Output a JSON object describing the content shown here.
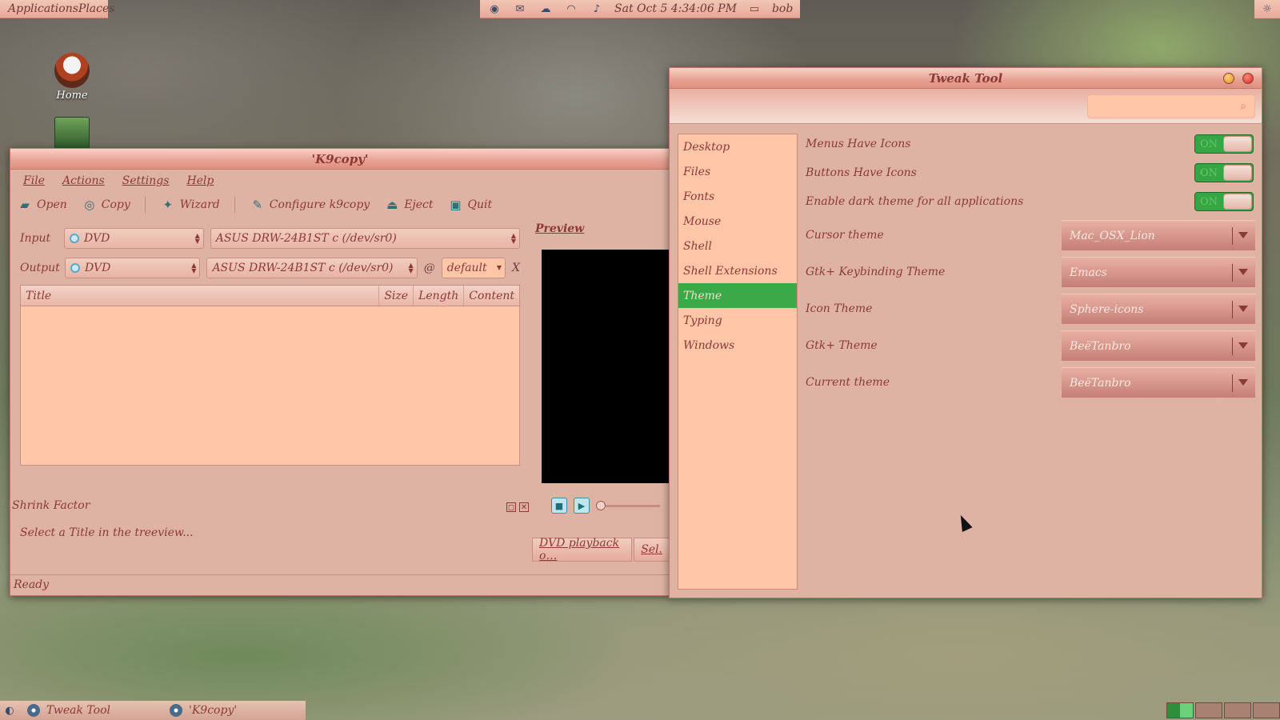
{
  "top_panel": {
    "menu_label": "ApplicationsPlaces",
    "clock": "Sat Oct  5   4:34:06 PM",
    "user": "bob"
  },
  "desktop": {
    "home_label": "Home"
  },
  "k9copy": {
    "title": "'K9copy'",
    "menu": [
      "File",
      "Actions",
      "Settings",
      "Help"
    ],
    "toolbar": {
      "open": "Open",
      "copy": "Copy",
      "wizard": "Wizard",
      "configure": "Configure k9copy",
      "eject": "Eject",
      "quit": "Quit"
    },
    "input_label": "Input",
    "output_label": "Output",
    "input_type": "DVD",
    "output_type": "DVD",
    "input_device": "ASUS    DRW-24B1ST   c  (/dev/sr0)",
    "output_device": "ASUS    DRW-24B1ST   c  (/dev/sr0)",
    "at_sign": "@",
    "speed": "default",
    "clear": "X",
    "columns": [
      "Title",
      "Size",
      "Length",
      "Content"
    ],
    "preview_label": "Preview",
    "shrink_label": "Shrink Factor",
    "hint": "Select a Title in the treeview...",
    "tabs": [
      "DVD playback o…",
      "Sel."
    ],
    "status": "Ready"
  },
  "tweak": {
    "title": "Tweak Tool",
    "search_placeholder": "",
    "sidebar": [
      "Desktop",
      "Files",
      "Fonts",
      "Mouse",
      "Shell",
      "Shell Extensions",
      "Theme",
      "Typing",
      "Windows"
    ],
    "active_index": 6,
    "switches": [
      {
        "label": "Menus Have Icons",
        "state": "ON"
      },
      {
        "label": "Buttons Have Icons",
        "state": "ON"
      },
      {
        "label": "Enable dark theme for all applications",
        "state": "ON"
      }
    ],
    "dropdowns": [
      {
        "label": "Cursor theme",
        "value": "Mac_OSX_Lion"
      },
      {
        "label": "Gtk+ Keybinding Theme",
        "value": "Emacs"
      },
      {
        "label": "Icon Theme",
        "value": "Sphere-icons"
      },
      {
        "label": "Gtk+ Theme",
        "value": "BeëTanbro"
      },
      {
        "label": "Current theme",
        "value": "BeëTanbro"
      }
    ]
  },
  "taskbar": {
    "tasks": [
      "Tweak Tool",
      "'K9copy'"
    ]
  },
  "colors": {
    "accent_active": "#3aaa48",
    "window_bg": "#dfb3a4",
    "list_bg": "#ffc6a8",
    "text": "#8b3a36"
  }
}
